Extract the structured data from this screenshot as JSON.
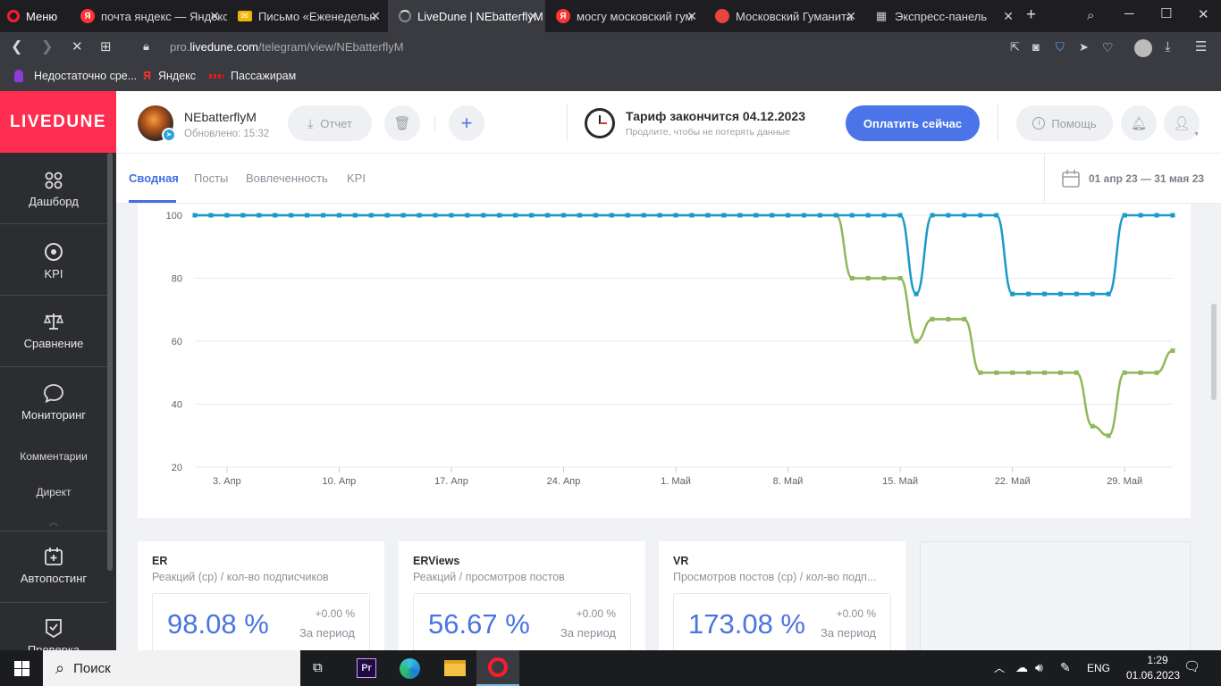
{
  "browser": {
    "menu_label": "Меню",
    "tabs": [
      {
        "title": "почта яндекс — Яндекс",
        "icon": "yandex-icon",
        "color": "#f33"
      },
      {
        "title": "Письмо «Еженедельн",
        "icon": "mail-icon",
        "color": "#f5b400"
      },
      {
        "title": "LiveDune | NEbatterflyM",
        "icon": "loading-icon",
        "color": "#777"
      },
      {
        "title": "мосгу московский гум",
        "icon": "yandex-icon",
        "color": "#f33"
      },
      {
        "title": "Московский Гуманита",
        "icon": "site-icon",
        "color": "#e8453c"
      },
      {
        "title": "Экспресс-панель",
        "icon": "grid-icon",
        "color": "#aaa"
      }
    ],
    "url_prefix": "pro.",
    "url_domain": "livedune.com",
    "url_path": "/telegram/view/NEbatterflyM",
    "bookmarks": [
      {
        "label": "Недостаточно сре...",
        "icon": "finger-icon"
      },
      {
        "label": "Яндекс",
        "icon": "yandex-icon"
      },
      {
        "label": "Пассажирам",
        "icon": "rail-icon"
      }
    ]
  },
  "sidebar": {
    "logo": "LIVEDUNE",
    "items": [
      {
        "label": "Дашборд",
        "icon": "dashboard-icon"
      },
      {
        "label": "KPI",
        "icon": "target-icon"
      },
      {
        "label": "Сравнение",
        "icon": "scales-icon"
      },
      {
        "label": "Мониторинг",
        "icon": "chat-bubble-icon"
      },
      {
        "label": "Комментарии"
      },
      {
        "label": "Директ"
      },
      {
        "label": "Автопостинг",
        "icon": "calendar-plus-icon"
      },
      {
        "label": "Проверка",
        "icon": "shield-check-icon"
      }
    ]
  },
  "header": {
    "account_name": "NEbatterflyM",
    "updated": "Обновлено: 15:32",
    "report_label": "Отчет",
    "tariff_title": "Тариф закончится 04.12.2023",
    "tariff_sub": "Продлите, чтобы не потерять данные",
    "pay_label": "Оплатить сейчас",
    "help_label": "Помощь"
  },
  "page_tabs": [
    "Сводная",
    "Посты",
    "Вовлеченность",
    "KPI"
  ],
  "active_tab": "Сводная",
  "date_range": "01 апр 23 — 31 мая 23",
  "chart_data": {
    "type": "line",
    "ylim": [
      20,
      100
    ],
    "y_ticks": [
      100,
      80,
      60,
      40,
      20
    ],
    "x_ticks": [
      "3. Апр",
      "10. Апр",
      "17. Апр",
      "24. Апр",
      "1. Май",
      "8. Май",
      "15. Май",
      "22. Май",
      "29. Май"
    ],
    "x_range_days": [
      1,
      62
    ],
    "series": [
      {
        "color": "#1a9ac9",
        "x": [
          1,
          2,
          3,
          4,
          5,
          6,
          7,
          8,
          9,
          10,
          11,
          12,
          13,
          14,
          15,
          16,
          17,
          18,
          19,
          20,
          21,
          22,
          23,
          24,
          25,
          26,
          27,
          28,
          29,
          30,
          31,
          32,
          33,
          34,
          35,
          36,
          37,
          38,
          39,
          40,
          41,
          42,
          43,
          44,
          45,
          46,
          47,
          48,
          49,
          50,
          51,
          52,
          53,
          54,
          55,
          56,
          57,
          58,
          59,
          60,
          61,
          62
        ],
        "values": [
          100,
          100,
          100,
          100,
          100,
          100,
          100,
          100,
          100,
          100,
          100,
          100,
          100,
          100,
          100,
          100,
          100,
          100,
          100,
          100,
          100,
          100,
          100,
          100,
          100,
          100,
          100,
          100,
          100,
          100,
          100,
          100,
          100,
          100,
          100,
          100,
          100,
          100,
          100,
          100,
          100,
          100,
          100,
          100,
          100,
          75,
          100,
          100,
          100,
          100,
          100,
          75,
          75,
          75,
          75,
          75,
          75,
          75,
          100,
          100,
          100,
          100
        ]
      },
      {
        "color": "#8fb85a",
        "x": [
          1,
          2,
          3,
          4,
          5,
          6,
          7,
          8,
          9,
          10,
          11,
          12,
          13,
          14,
          15,
          16,
          17,
          18,
          19,
          20,
          21,
          22,
          23,
          24,
          25,
          26,
          27,
          28,
          29,
          30,
          31,
          32,
          33,
          34,
          35,
          36,
          37,
          38,
          39,
          40,
          41,
          42,
          43,
          44,
          45,
          46,
          47,
          48,
          49,
          50,
          51,
          52,
          53,
          54,
          55,
          56,
          57,
          58,
          59,
          60,
          61,
          62
        ],
        "values": [
          100,
          100,
          100,
          100,
          100,
          100,
          100,
          100,
          100,
          100,
          100,
          100,
          100,
          100,
          100,
          100,
          100,
          100,
          100,
          100,
          100,
          100,
          100,
          100,
          100,
          100,
          100,
          100,
          100,
          100,
          100,
          100,
          100,
          100,
          100,
          100,
          100,
          100,
          100,
          100,
          100,
          80,
          80,
          80,
          80,
          60,
          67,
          67,
          67,
          50,
          50,
          50,
          50,
          50,
          50,
          50,
          33,
          30,
          50,
          50,
          50,
          57
        ]
      }
    ]
  },
  "metrics": [
    {
      "title": "ER",
      "subtitle": "Реакций (ср) / кол-во подписчиков",
      "value": "98.08 %",
      "delta": "+0.00 %",
      "period": "За период"
    },
    {
      "title": "ERViews",
      "subtitle": "Реакций / просмотров постов",
      "value": "56.67 %",
      "delta": "+0.00 %",
      "period": "За период"
    },
    {
      "title": "VR",
      "subtitle": "Просмотров постов (ср) / кол-во подп...",
      "value": "173.08 %",
      "delta": "+0.00 %",
      "period": "За период"
    }
  ],
  "taskbar": {
    "search_placeholder": "Поиск",
    "lang": "ENG",
    "time": "1:29",
    "date": "01.06.2023"
  }
}
